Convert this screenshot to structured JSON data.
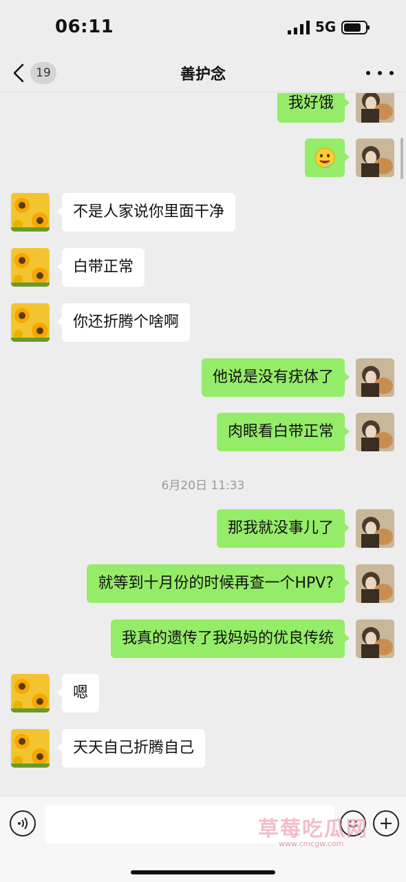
{
  "status_bar": {
    "time": "06:11",
    "network": "5G",
    "icons": [
      "signal-icon",
      "battery-icon"
    ]
  },
  "nav": {
    "unread_count": "19",
    "title": "善护念",
    "icons": [
      "chevron-left-icon",
      "more-icon"
    ]
  },
  "messages": [
    {
      "side": "right",
      "type": "text",
      "text": "我好饿"
    },
    {
      "side": "right",
      "type": "emoji",
      "emoji": "🤤"
    },
    {
      "side": "left",
      "type": "text",
      "text": "不是人家说你里面干净"
    },
    {
      "side": "left",
      "type": "text",
      "text": "白带正常"
    },
    {
      "side": "left",
      "type": "text",
      "text": "你还折腾个啥啊"
    },
    {
      "side": "right",
      "type": "text",
      "text": "他说是没有疣体了"
    },
    {
      "side": "right",
      "type": "text",
      "text": "肉眼看白带正常"
    },
    {
      "type": "timestamp",
      "text": "6月20日 11:33"
    },
    {
      "side": "right",
      "type": "text",
      "text": "那我就没事儿了"
    },
    {
      "side": "right",
      "type": "text",
      "text": "就等到十月份的时候再查一个HPV?"
    },
    {
      "side": "right",
      "type": "text",
      "text": "我真的遗传了我妈妈的优良传统"
    },
    {
      "side": "left",
      "type": "text",
      "text": "嗯"
    },
    {
      "side": "left",
      "type": "text",
      "text": "天天自己折腾自己"
    }
  ],
  "input_bar": {
    "input_value": "",
    "icons": [
      "voice-icon",
      "emoji-icon",
      "plus-icon"
    ]
  },
  "watermark": {
    "text": "草莓吃瓜网",
    "sub": "www.cmcgw.com"
  },
  "colors": {
    "background": "#ededed",
    "sent_bubble": "#95ec69",
    "received_bubble": "#ffffff",
    "timestamp": "#9a9a9a"
  }
}
